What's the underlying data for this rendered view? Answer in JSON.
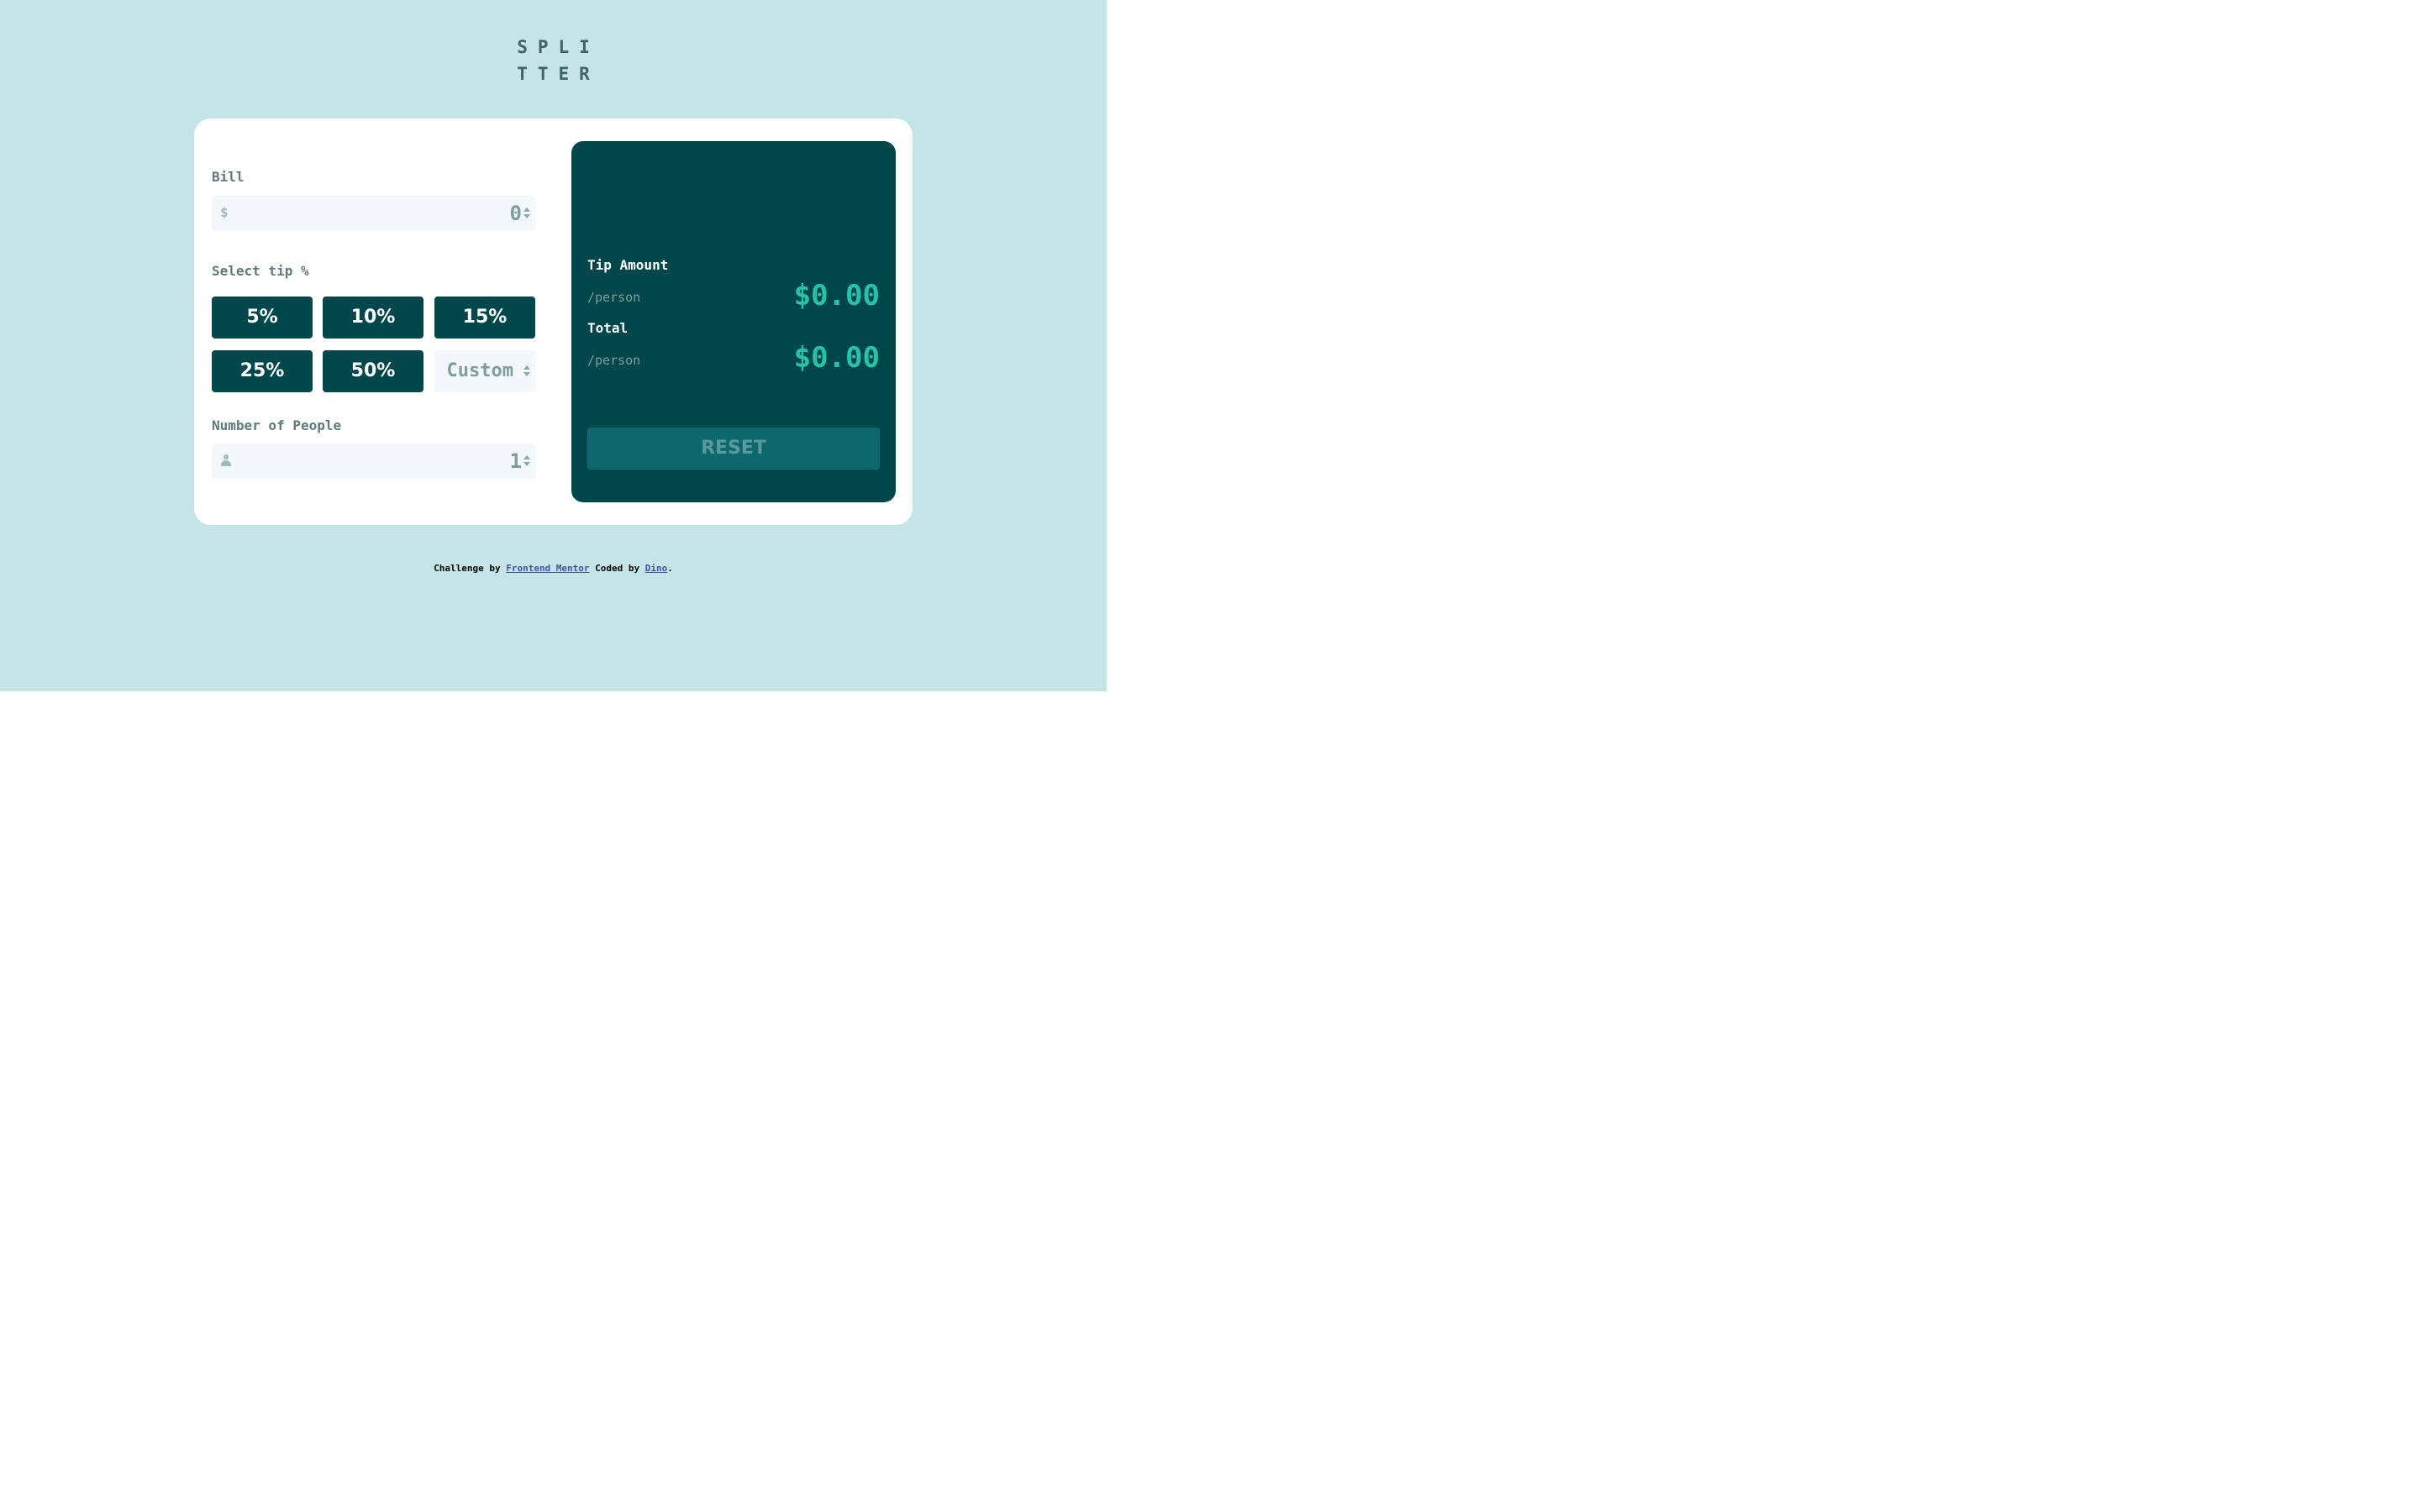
{
  "logo": {
    "line1": "SPLI",
    "line2": "TTER"
  },
  "bill": {
    "label": "Bill",
    "prefix": "$",
    "value": "0"
  },
  "tip": {
    "label": "Select tip %",
    "options": [
      "5%",
      "10%",
      "15%",
      "25%",
      "50%"
    ],
    "custom_placeholder": "Custom"
  },
  "people": {
    "label": "Number of People",
    "value": "1"
  },
  "results": {
    "tip_label": "Tip Amount",
    "tip_sub": "/person",
    "tip_amount": "$0.00",
    "total_label": "Total",
    "total_sub": "/person",
    "total_amount": "$0.00",
    "reset_label": "RESET"
  },
  "footer": {
    "prefix": "Challenge by",
    "fm_link": "Frontend Mentor",
    "middle": "Coded by",
    "author_link": "Dino",
    "suffix": "."
  },
  "colors": {
    "background": "#c5e4e7",
    "dark_cyan": "#00474b",
    "strong_cyan": "#26c2ae",
    "input_bg": "#f3f9fa"
  }
}
